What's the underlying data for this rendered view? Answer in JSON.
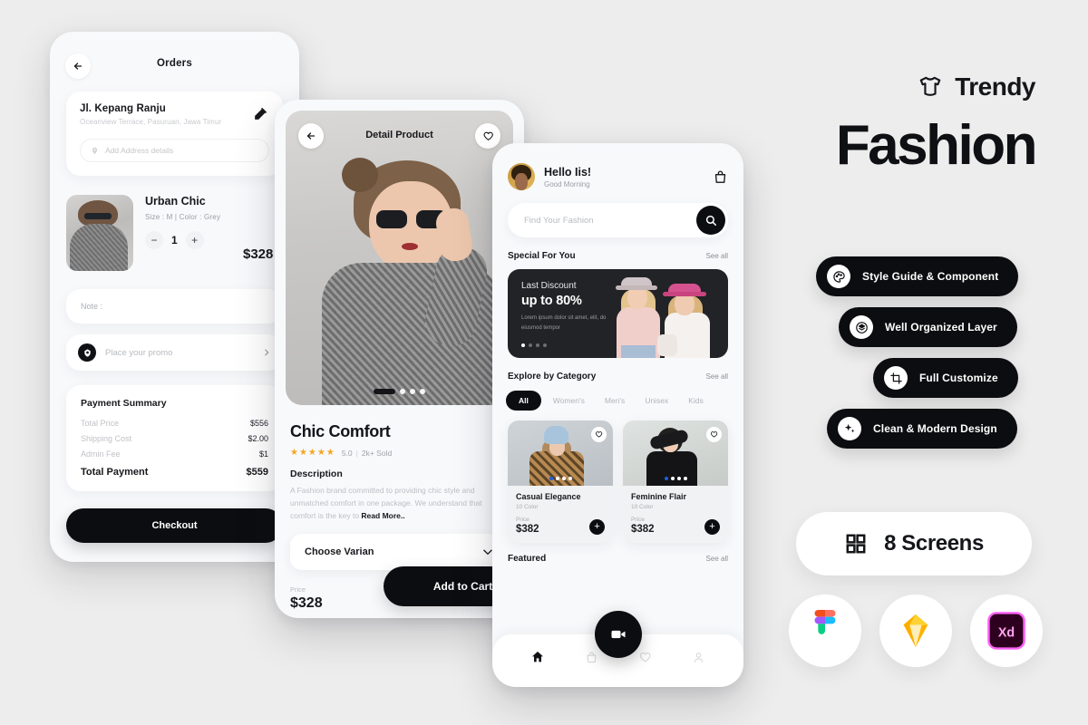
{
  "brand": {
    "logo_icon": "tshirt-icon",
    "name": "Trendy",
    "hero_word": "Fashion"
  },
  "features": [
    {
      "icon": "palette-icon",
      "label": "Style Guide & Component"
    },
    {
      "icon": "layers-icon",
      "label": "Well Organized Layer"
    },
    {
      "icon": "crop-icon",
      "label": "Full Customize"
    },
    {
      "icon": "sparkle-icon",
      "label": "Clean & Modern Design"
    }
  ],
  "screens_badge": {
    "icon": "grid-icon",
    "label": "8 Screens"
  },
  "tool_logos": [
    {
      "name": "figma-logo"
    },
    {
      "name": "sketch-logo"
    },
    {
      "name": "adobe-xd-logo"
    }
  ],
  "orders_screen": {
    "back_icon": "arrow-left-icon",
    "title": "Orders",
    "address": {
      "name": "Jl. Kepang Ranju",
      "detail": "Oceanview Terrace, Pasuruan, Jawa Timur",
      "edit_icon": "edit-pencil-icon",
      "input_placeholder": "Add Address details",
      "input_icon": "location-pin-icon"
    },
    "item": {
      "name": "Urban Chic",
      "meta": "Size : M   |   Color : Grey",
      "minus": "−",
      "qty": "1",
      "plus": "+",
      "price": "$328"
    },
    "note_placeholder": "Note :",
    "promo": {
      "icon": "ticket-icon",
      "placeholder": "Place your promo",
      "chevron": "›"
    },
    "payment_summary": {
      "title": "Payment Summary",
      "rows": [
        {
          "label": "Total Price",
          "value": "$556"
        },
        {
          "label": "Shipping Cost",
          "value": "$2.00"
        },
        {
          "label": "Admin Fee",
          "value": "$1"
        }
      ],
      "total_label": "Total Payment",
      "total_value": "$559"
    },
    "checkout_label": "Checkout"
  },
  "detail_screen": {
    "back_icon": "arrow-left-icon",
    "title": "Detail Product",
    "favorite_icon": "heart-outline-icon",
    "product_name": "Chic Comfort",
    "product_price": "$328",
    "stars": "★★★★★",
    "rating": "5.0",
    "separator": "|",
    "sold": "2k+ Sold",
    "description_title": "Description",
    "description": "A Fashion brand committed to providing chic style and unmatched comfort in one package. We understand that comfort is the key to ",
    "read_more": "Read More..",
    "variant_label": "Choose Varian",
    "variant_chevron": "chevron-down-icon",
    "price_label": "Price",
    "price_value": "$328",
    "add_to_cart": "Add to Cart"
  },
  "home_screen": {
    "avatar": "user-avatar",
    "greeting": "Hello Iis!",
    "greeting_sub": "Good Morning",
    "bag_icon": "shopping-bag-icon",
    "search_placeholder": "Find Your Fashion",
    "search_icon": "search-icon",
    "sections": {
      "special": {
        "title": "Special For You",
        "see_all": "See all"
      },
      "category": {
        "title": "Explore by Category",
        "see_all": "See all"
      },
      "featured": {
        "title": "Featured",
        "see_all": "See all"
      }
    },
    "banner": {
      "line1": "Last Discount",
      "line2": "up to 80%",
      "line3": "Lorem ipsum dolor sit amet, elit, do eiusmod tempor"
    },
    "categories": [
      "All",
      "Women's",
      "Men's",
      "Unisex",
      "Kids"
    ],
    "active_category": "All",
    "products": [
      {
        "name": "Casual Elegance",
        "colors": "10 Color",
        "price_label": "Price",
        "price": "$382",
        "fav_icon": "heart-outline-icon",
        "add_icon": "plus-icon"
      },
      {
        "name": "Feminine Flair",
        "colors": "10 Color",
        "price_label": "Price",
        "price": "$382",
        "fav_icon": "heart-outline-icon",
        "add_icon": "plus-icon"
      }
    ],
    "fab_icon": "video-camera-icon",
    "tabs": [
      {
        "icon": "home-icon",
        "active": true
      },
      {
        "icon": "bag-icon",
        "active": false
      },
      {
        "icon": "heart-icon",
        "active": false
      },
      {
        "icon": "profile-icon",
        "active": false
      }
    ]
  },
  "colors": {
    "background": "#ededed",
    "dark": "#0c0d10",
    "card": "#ffffff",
    "star": "#f5a623"
  }
}
